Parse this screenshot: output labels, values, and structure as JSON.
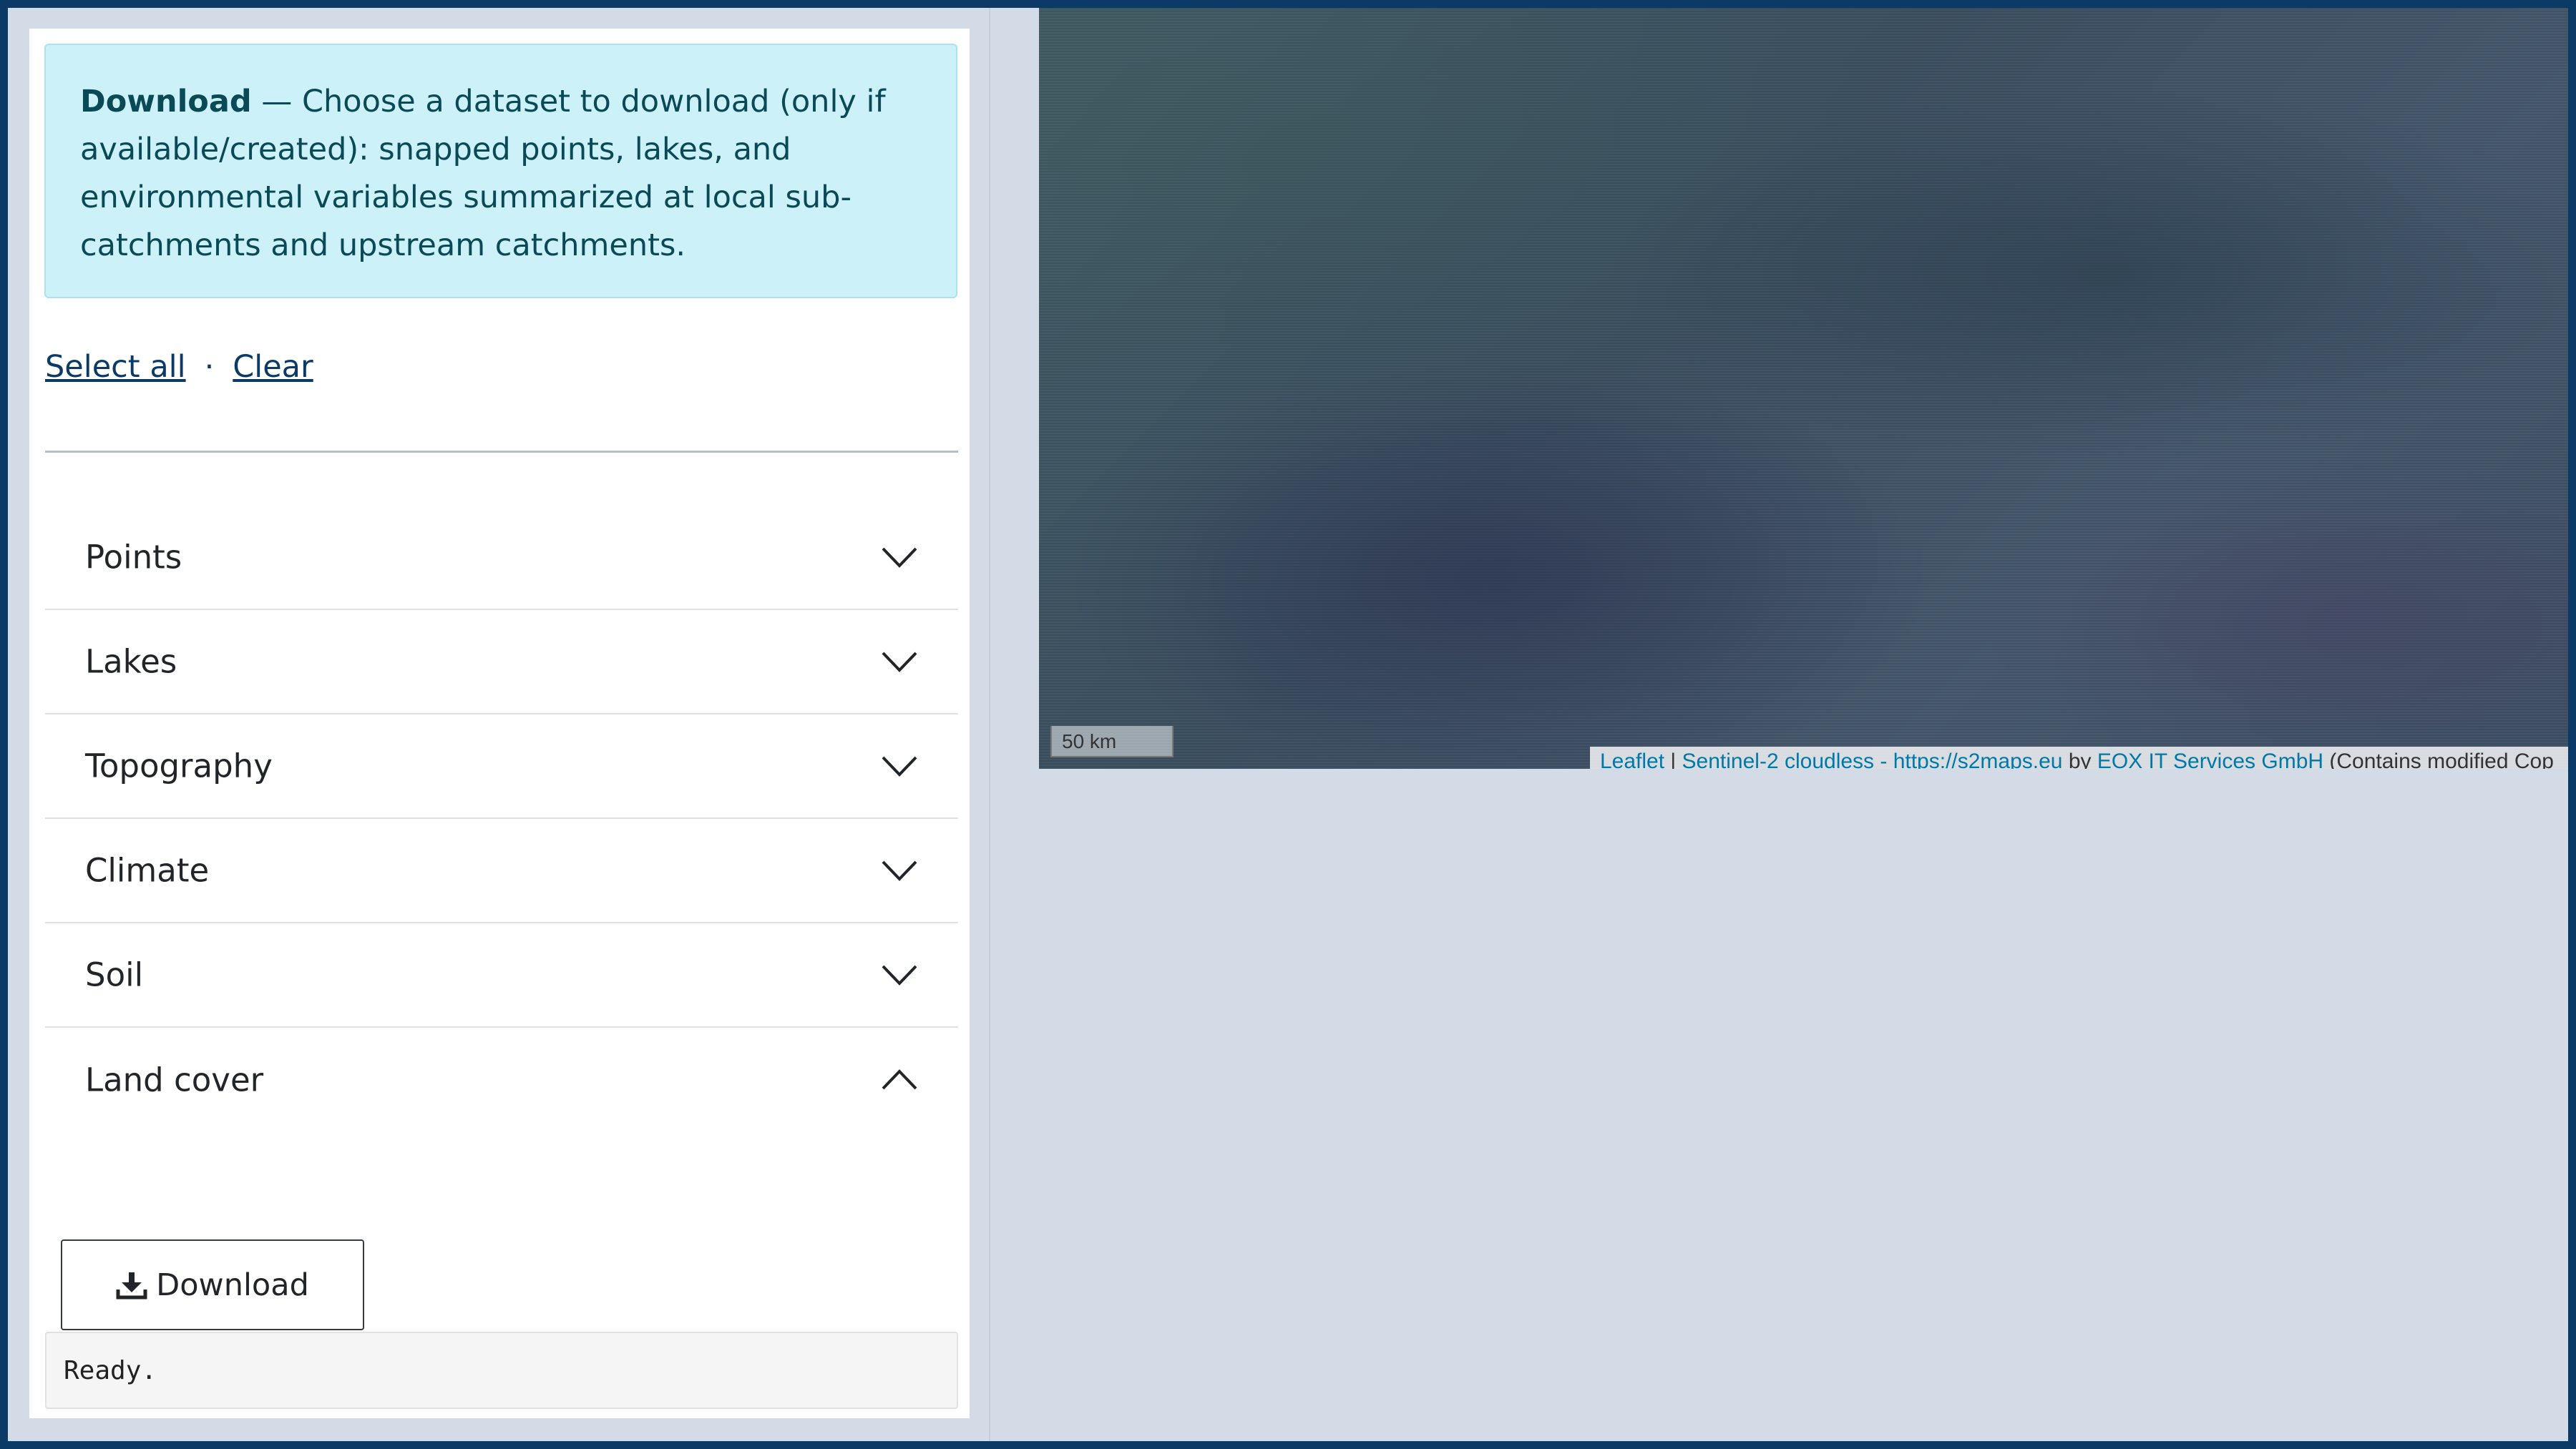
{
  "info": {
    "title": "Download",
    "text": " — Choose a dataset to download (only if available/created): snapped points, lakes, and environmental variables summarized at local sub-catchments and upstream catchments."
  },
  "links": {
    "select_all": "Select all",
    "separator": "·",
    "clear": "Clear"
  },
  "accordion": [
    {
      "label": "Points",
      "expanded": false
    },
    {
      "label": "Lakes",
      "expanded": false
    },
    {
      "label": "Topography",
      "expanded": false
    },
    {
      "label": "Climate",
      "expanded": false
    },
    {
      "label": "Soil",
      "expanded": false
    },
    {
      "label": "Land cover",
      "expanded": true
    }
  ],
  "download_button": {
    "label": "Download",
    "icon": "download-icon"
  },
  "status": {
    "text": "Ready."
  },
  "map": {
    "scale_label": "50 km",
    "attribution": {
      "leaflet": "Leaflet",
      "sep1": " | ",
      "sentinel": "Sentinel-2 cloudless - https://s2maps.eu",
      "by": " by ",
      "eox": "EOX IT Services GmbH",
      "rest": " (Contains modified Cop"
    }
  },
  "colors": {
    "frame": "#0b3a66",
    "info_bg": "#cdf1f8",
    "info_text": "#0a4a57",
    "link": "#0b3a66",
    "map_link": "#0078a8"
  }
}
